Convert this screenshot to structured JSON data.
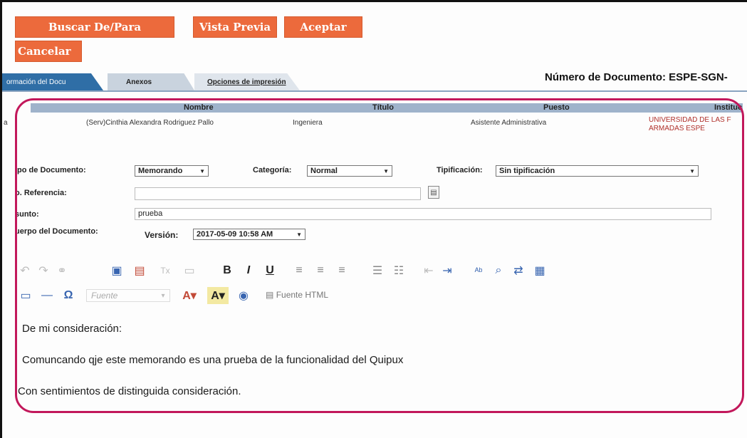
{
  "actions": {
    "buscar": "Buscar De/Para",
    "vista_previa": "Vista Previa",
    "aceptar": "Aceptar",
    "cancelar": "Cancelar"
  },
  "tabs": [
    {
      "label": "ormación del Docu"
    },
    {
      "label": "Anexos"
    },
    {
      "label": "Opciones de impresión"
    }
  ],
  "document_number": "Número de Documento: ESPE-SGN-",
  "recipients": {
    "headers": [
      "Nombre",
      "Título",
      "Puesto",
      "Instituc"
    ],
    "row": {
      "marker": "a",
      "nombre": "(Serv)Cinthia Alexandra Rodriguez Pallo",
      "titulo": "Ingeniera",
      "puesto": "Asistente Administrativa",
      "institucion_1": "UNIVERSIDAD DE LAS F",
      "institucion_2": "ARMADAS ESPE"
    }
  },
  "form": {
    "tipo_label": "ipo de Documento:",
    "tipo_value": "Memorando",
    "categoria_label": "Categoría:",
    "categoria_value": "Normal",
    "tipificacion_label": "Tipificación:",
    "tipificacion_value": "Sin tipificación",
    "referencia_label": "o. Referencia:",
    "referencia_value": "",
    "asunto_label": "sunto:",
    "asunto_value": "prueba",
    "cuerpo_label": "uerpo del Documento:",
    "version_label": "Versión:",
    "version_value": "2017-05-09 10:58 AM"
  },
  "toolbar": {
    "fuente_placeholder": "Fuente",
    "fuente_html": "Fuente HTML"
  },
  "editor": {
    "lines": [
      "De mi consideración:",
      "Comuncando qje este memorando es una prueba de la funcionalidad del Quipux",
      "Con sentimientos de distinguida consideración."
    ]
  },
  "colors": {
    "action_button": "#ec6a3c",
    "active_tab": "#2f6ea6",
    "header_bar": "#9fb3cb",
    "highlight": "#c2185b"
  }
}
